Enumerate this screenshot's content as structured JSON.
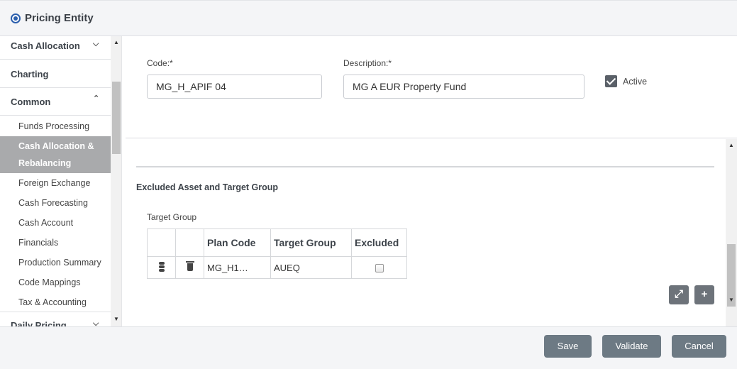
{
  "header": {
    "title": "Pricing Entity"
  },
  "sidebar": {
    "sections": [
      {
        "label": "Cash Allocation",
        "chevron": "chevron-down-icon"
      },
      {
        "label": "Charting"
      },
      {
        "label": "Common",
        "chevron": "chevron-up-icon"
      }
    ],
    "items": [
      {
        "label": "Funds Processing"
      },
      {
        "label": "Cash Allocation &"
      },
      {
        "label": "Rebalancing"
      },
      {
        "label": "Foreign Exchange"
      },
      {
        "label": "Cash Forecasting"
      },
      {
        "label": "Cash Account"
      },
      {
        "label": "Financials"
      },
      {
        "label": "Production Summary"
      },
      {
        "label": "Code Mappings"
      },
      {
        "label": "Tax & Accounting"
      }
    ],
    "bottom_section": {
      "label": "Daily Pricing"
    },
    "active_color": "#a9aaac"
  },
  "form": {
    "code_label": "Code:*",
    "code_value": "MG_H_APIF 04",
    "description_label": "Description:*",
    "description_value": "MG A EUR Property Fund",
    "active_label": "Active",
    "active_checked": true
  },
  "excluded": {
    "section_title": "Excluded Asset and Target Group",
    "grid_label": "Target Group",
    "columns": [
      "Plan Code",
      "Target Group",
      "Excluded"
    ],
    "rows": [
      {
        "plan_code": "MG_H1…",
        "target_group": "AUEQ",
        "excluded": false
      }
    ]
  },
  "footer": {
    "save_label": "Save",
    "validate_label": "Validate",
    "cancel_label": "Cancel",
    "button_color": "#6d7a84"
  }
}
